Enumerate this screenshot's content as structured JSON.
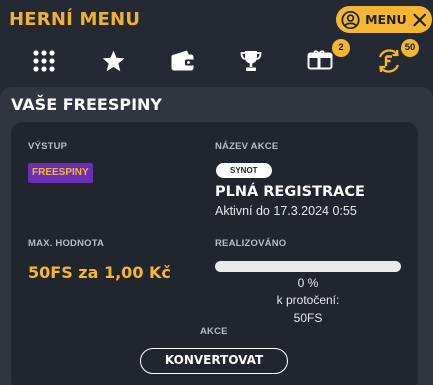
{
  "header": {
    "title": "HERNÍ MENU",
    "menu_button_label": "MENU"
  },
  "iconbar": {
    "items": [
      {
        "icon": "grid-icon"
      },
      {
        "icon": "star-icon"
      },
      {
        "icon": "wallet-icon"
      },
      {
        "icon": "trophy-icon"
      },
      {
        "icon": "gift-card-icon",
        "badge": "2"
      },
      {
        "icon": "freespin-icon",
        "badge": "50"
      }
    ]
  },
  "panel": {
    "title": "VAŠE FREESPINY",
    "labels": {
      "output": "VÝSTUP",
      "promo_name": "NÁZEV AKCE",
      "max_value": "MAX. HODNOTA",
      "realized": "REALIZOVÁNO",
      "action": "AKCE"
    },
    "output_chip": "FREESPINY",
    "provider_chip": "SYNOT",
    "promo_name": "PLNÁ REGISTRACE",
    "promo_status": "Aktivní do 17.3.2024 0:55",
    "max_value": "50FS za 1,00 Kč",
    "progress_percent": 0,
    "progress_text": "0 %",
    "rollover_label": "k protočení:",
    "rollover_value": "50FS",
    "convert_button": "KONVERTOVAT"
  },
  "colors": {
    "accent": "#f5b731",
    "background": "#252933",
    "panel": "#30353f",
    "card": "#21252e",
    "chip_purple": "#6b2eb4"
  }
}
